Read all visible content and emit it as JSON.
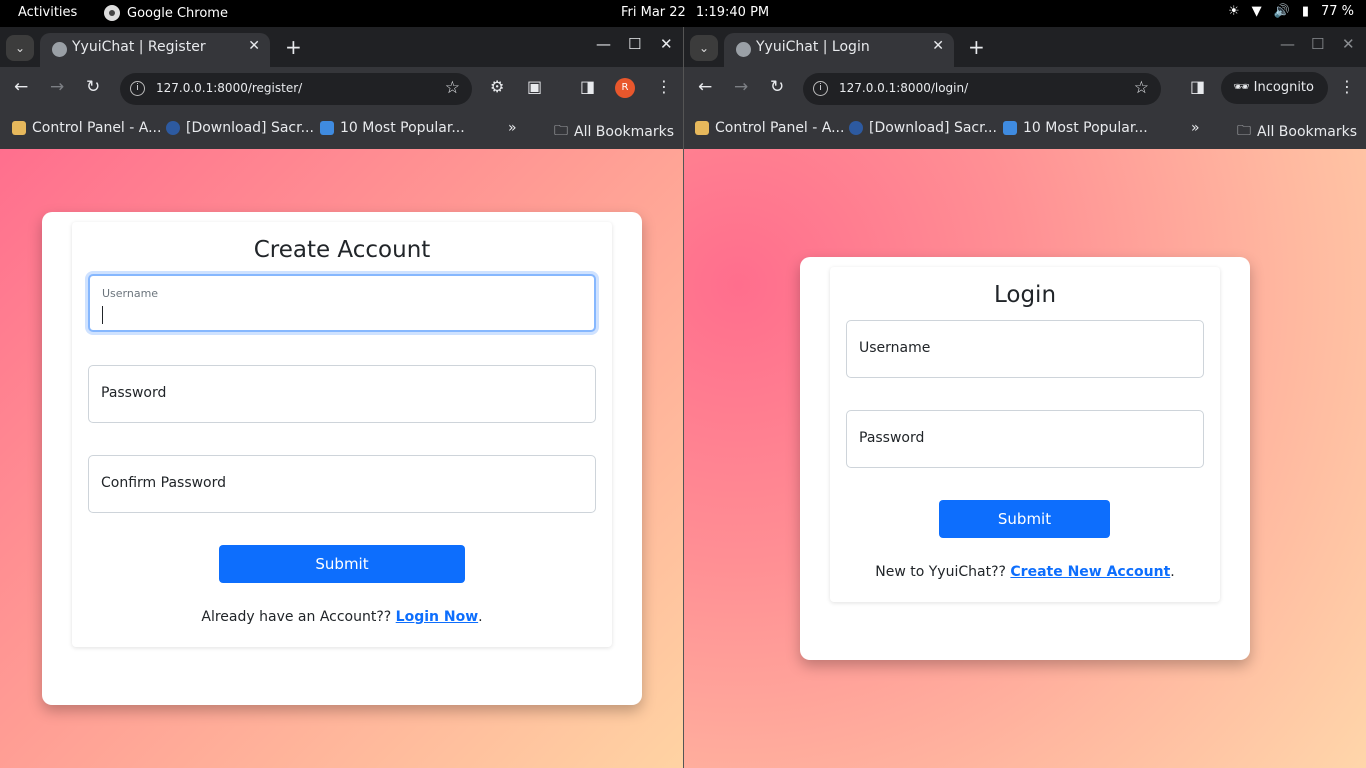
{
  "system": {
    "activities": "Activities",
    "app_name": "Google Chrome",
    "date": "Fri Mar 22",
    "time": "1:19:40 PM",
    "battery": "77 %"
  },
  "left_window": {
    "tab_title": "YyuiChat | Register",
    "url": "127.0.0.1:8000/register/",
    "avatar_letter": "R",
    "bookmarks": [
      "Control Panel - A...",
      "[Download] Sacr...",
      "10 Most Popular..."
    ],
    "all_bookmarks": "All Bookmarks",
    "form": {
      "title": "Create Account",
      "username_label": "Username",
      "password_label": "Password",
      "confirm_label": "Confirm Password",
      "submit": "Submit",
      "footer_text": "Already have an Account?? ",
      "footer_link": "Login Now",
      "footer_end": "."
    }
  },
  "right_window": {
    "tab_title": "YyuiChat | Login",
    "url": "127.0.0.1:8000/login/",
    "incognito": "Incognito",
    "bookmarks": [
      "Control Panel - A...",
      "[Download] Sacr...",
      "10 Most Popular..."
    ],
    "all_bookmarks": "All Bookmarks",
    "form": {
      "title": "Login",
      "username_label": "Username",
      "password_label": "Password",
      "submit": "Submit",
      "footer_text": "New to YyuiChat?? ",
      "footer_link": "Create New Account",
      "footer_end": "."
    }
  }
}
